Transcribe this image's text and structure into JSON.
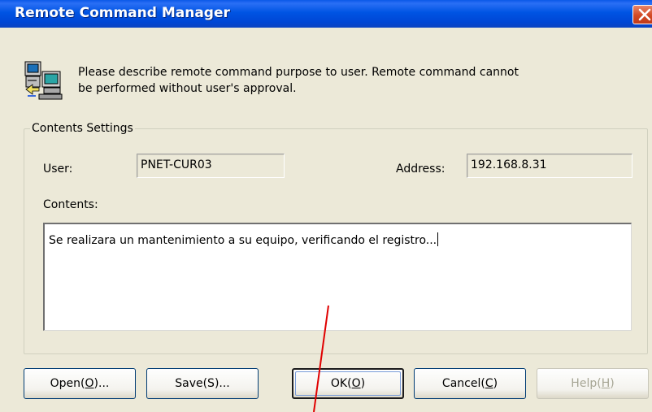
{
  "window": {
    "title": "Remote Command Manager",
    "close_icon": "close-icon"
  },
  "info": {
    "icon": "computer-network-icon",
    "message": "Please describe remote command purpose to user. Remote command cannot be performed without user's approval."
  },
  "group": {
    "legend": "Contents Settings",
    "user_label": "User:",
    "user_value": "PNET-CUR03",
    "address_label": "Address:",
    "address_value": "192.168.8.31",
    "contents_label": "Contents:",
    "contents_value": "Se realizara un mantenimiento a su equipo, verificando el registro..."
  },
  "buttons": {
    "open": {
      "label": "Open(",
      "mnemonic": "O",
      "suffix": ")..."
    },
    "save": {
      "label": "Save(S)..."
    },
    "ok": {
      "label": "OK(",
      "mnemonic": "O",
      "suffix": ")"
    },
    "cancel": {
      "label": "Cancel(",
      "mnemonic": "C",
      "suffix": ")"
    },
    "help": {
      "label": "Help(",
      "mnemonic": "H",
      "suffix": ")"
    }
  },
  "colors": {
    "titlebar": "#0054e3",
    "dialog_bg": "#ece9d8",
    "annotation_line": "#e00000"
  }
}
